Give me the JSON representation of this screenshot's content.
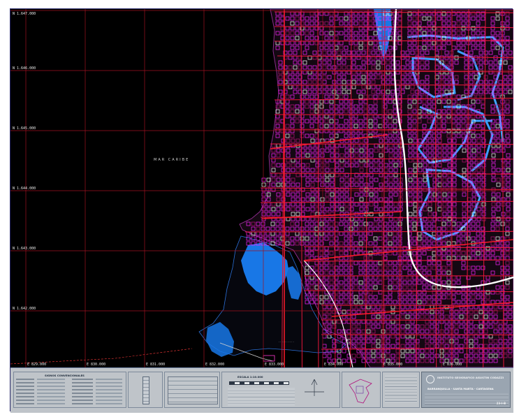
{
  "map": {
    "sea_label": "MAR CARIBE",
    "colors": {
      "background": "#000000",
      "grid": "#a01220",
      "streets": "#e8163a",
      "blocks": "#ff22ff",
      "water": "#1877e6",
      "canal_edge": "#3aa0ff",
      "coastline": "#8b2a8a",
      "highway": "#ffffff"
    },
    "eastings": [
      "E 829.000",
      "E 830.000",
      "E 831.000",
      "E 832.000",
      "E 833.000",
      "E 834.000",
      "E 835.000",
      "E 836.000"
    ],
    "northings": [
      "N 1.647.000",
      "N 1.646.000",
      "N 1.645.000",
      "N 1.644.000",
      "N 1.643.000",
      "N 1.642.000"
    ]
  },
  "title_block": {
    "signs_header": "SIGNOS CONVENCIONALES",
    "scale_label": "ESCALA 1:10.000",
    "institution": "INSTITUTO GEOGRAFICO AGUSTIN CODAZZI",
    "sheet_title": "BARRANQUILLA - SANTA MARTA - CARTAGENA",
    "sheet_number": "23-I-B"
  }
}
